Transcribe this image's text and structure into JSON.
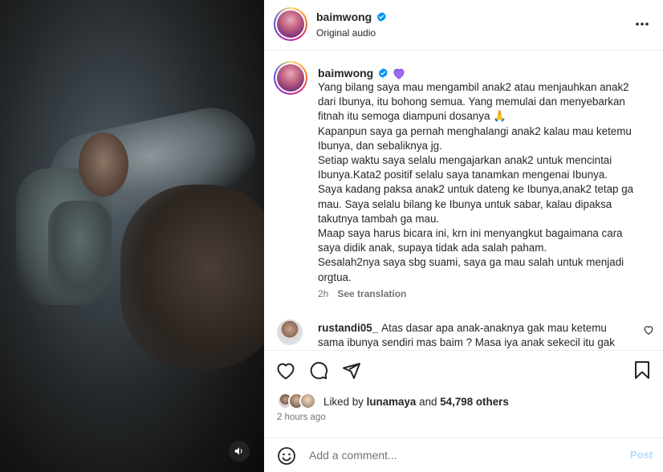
{
  "post": {
    "username": "baimwong",
    "audio_label": "Original audio",
    "more_icon": "more-horizontal-icon"
  },
  "caption": {
    "username": "baimwong",
    "text": "Yang bilang saya mau mengambil anak2 atau menjauhkan anak2 dari Ibunya, itu bohong semua. Yang memulai dan menyebarkan fitnah itu semoga diampuni dosanya 🙏\nKapanpun saya ga pernah menghalangi anak2 kalau mau ketemu Ibunya, dan sebaliknya jg.\nSetiap waktu saya selalu mengajarkan anak2 untuk mencintai Ibunya.Kata2 positif selalu saya tanamkan mengenai Ibunya.\nSaya kadang paksa anak2 untuk dateng ke Ibunya,anak2 tetap ga mau. Saya selalu bilang ke Ibunya untuk sabar, kalau dipaksa takutnya tambah ga mau.\nMaap saya harus bicara ini, krn ini menyangkut bagaimana cara saya didik anak, supaya tidak ada salah paham.\nSesalah2nya saya sbg suami, saya ga mau salah untuk menjadi orgtua.",
    "time": "2h",
    "see_translation": "See translation"
  },
  "comments": [
    {
      "username": "rustandi05_",
      "text": "Atas dasar apa anak-anaknya gak mau ketemu sama ibunya sendiri mas baim ? Masa iya anak sekecil itu gak"
    }
  ],
  "actions": {
    "liked_by_prefix": "Liked by",
    "liked_by_user": "lunamaya",
    "and_text": "and",
    "likes_count": "54,798 others",
    "time_ago": "2 hours ago"
  },
  "comment_box": {
    "placeholder": "Add a comment...",
    "post_label": "Post"
  },
  "colors": {
    "verified": "#0095f6",
    "heart_badge": "#9b6bf2",
    "post_disabled": "#b3dbff",
    "muted": "#737373"
  }
}
